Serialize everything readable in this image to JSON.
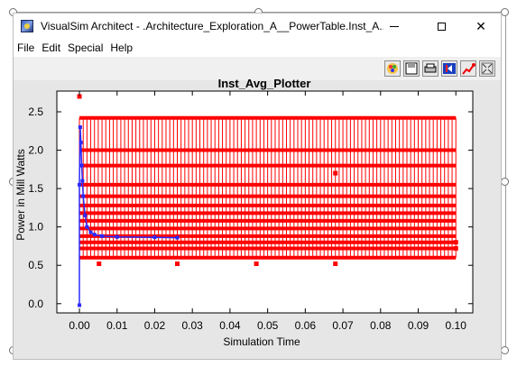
{
  "window": {
    "title": "VisualSim Architect - .Architecture_Exploration_A__PowerTable.Inst_A...",
    "controls": {
      "minimize": "minimize",
      "maximize": "maximize",
      "close": "✕"
    }
  },
  "menu": {
    "items": [
      "File",
      "Edit",
      "Special",
      "Help"
    ]
  },
  "toolbar": {
    "buttons": [
      "color-palette-icon",
      "save-icon",
      "print-icon",
      "reset-axes-icon",
      "fill-plot-icon",
      "fit-icon"
    ]
  },
  "colors": {
    "series": "#ff0000",
    "series2": "#2a2aff",
    "plot_bg": "#ffffff",
    "frame_bg": "#e6e6e6"
  },
  "chart_data": {
    "type": "scatter",
    "title": "Inst_Avg_Plotter",
    "xlabel": "Simulation Time",
    "ylabel": "Power in Mill Watts",
    "xlim": [
      -0.006,
      0.1045
    ],
    "ylim": [
      -0.12,
      2.77
    ],
    "xticks": [
      "0.00",
      "0.01",
      "0.02",
      "0.03",
      "0.04",
      "0.05",
      "0.06",
      "0.07",
      "0.08",
      "0.09",
      "0.10"
    ],
    "yticks": [
      "0.0",
      "0.5",
      "1.0",
      "1.5",
      "2.0",
      "2.5"
    ],
    "grid": false,
    "legend": "none",
    "series": [
      {
        "values_style": "stem",
        "stem_x_range": [
          0.0,
          0.1
        ],
        "stem_spacing": 0.001,
        "stem_levels": [
          0.6,
          0.72,
          0.8,
          0.88,
          0.98,
          1.08,
          1.18,
          1.28,
          1.4,
          1.55,
          1.8,
          2.0,
          2.42
        ],
        "isolated_points": [
          {
            "x": 0.0,
            "y": 2.7
          },
          {
            "x": 0.0052,
            "y": 0.52
          },
          {
            "x": 0.026,
            "y": 0.52
          },
          {
            "x": 0.047,
            "y": 0.52
          },
          {
            "x": 0.068,
            "y": 0.52
          },
          {
            "x": 0.068,
            "y": 1.7
          },
          {
            "x": 0.1,
            "y": 0.8
          },
          {
            "x": 0.1,
            "y": 0.72
          }
        ]
      },
      {
        "name": "",
        "values_style": "decay",
        "points": [
          {
            "x": 0.0,
            "y": -0.02
          },
          {
            "x": 0.0,
            "y": 1.55
          },
          {
            "x": 0.0002,
            "y": 2.3
          },
          {
            "x": 0.0004,
            "y": 2.1
          },
          {
            "x": 0.0006,
            "y": 1.8
          },
          {
            "x": 0.0008,
            "y": 1.6
          },
          {
            "x": 0.001,
            "y": 1.4
          },
          {
            "x": 0.0015,
            "y": 1.15
          },
          {
            "x": 0.002,
            "y": 1.0
          },
          {
            "x": 0.003,
            "y": 0.93
          },
          {
            "x": 0.004,
            "y": 0.9
          },
          {
            "x": 0.006,
            "y": 0.88
          },
          {
            "x": 0.01,
            "y": 0.87
          },
          {
            "x": 0.02,
            "y": 0.865
          },
          {
            "x": 0.026,
            "y": 0.86
          }
        ]
      }
    ]
  }
}
